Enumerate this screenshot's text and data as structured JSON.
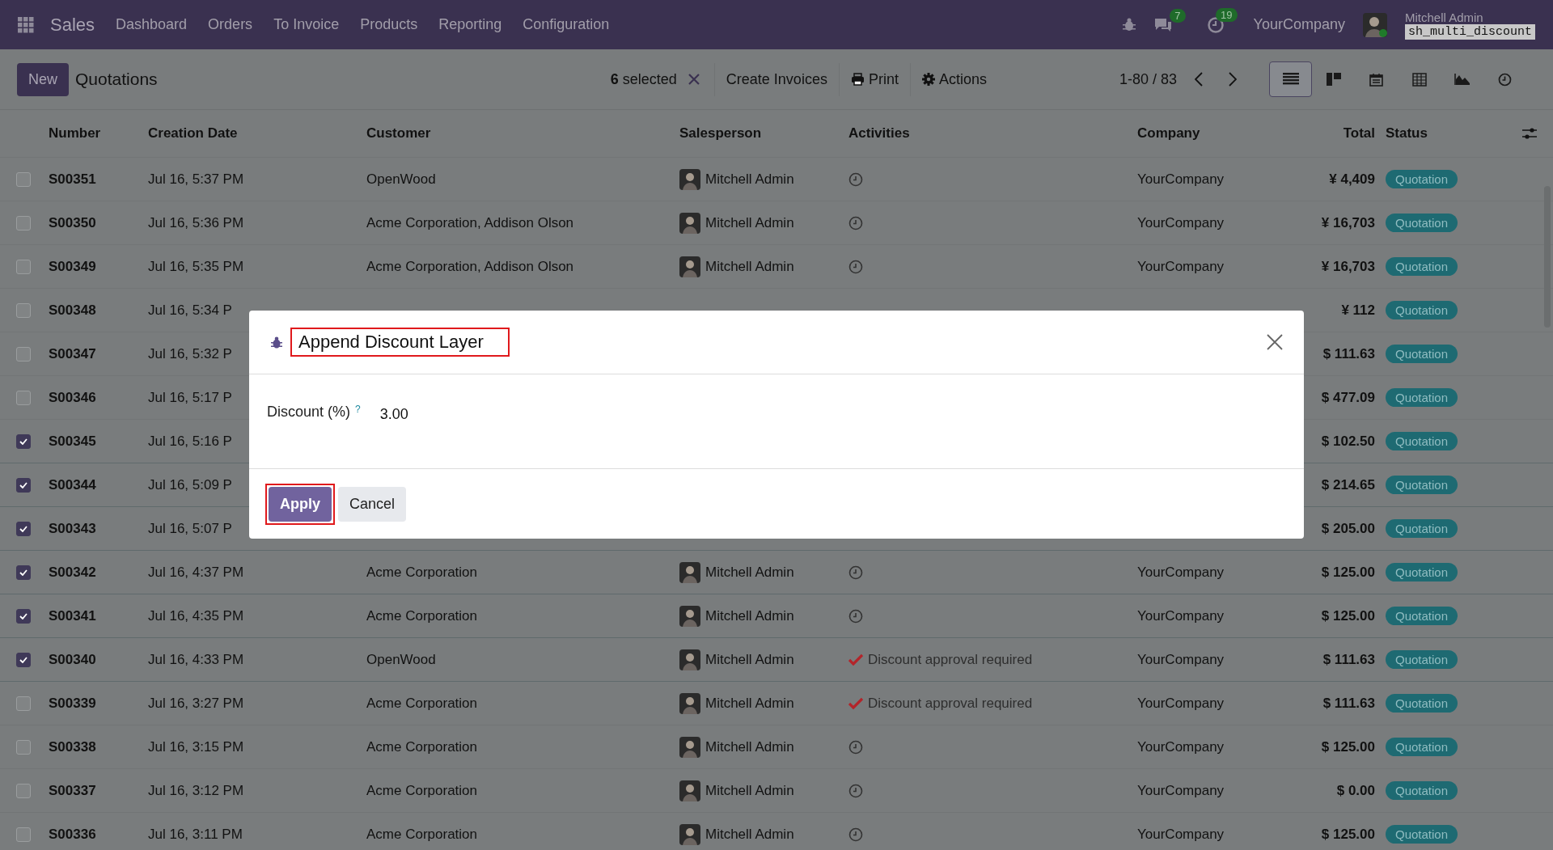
{
  "topbar": {
    "app": "Sales",
    "menu": [
      "Dashboard",
      "Orders",
      "To Invoice",
      "Products",
      "Reporting",
      "Configuration"
    ],
    "chat_count": "7",
    "activity_count": "19",
    "company": "YourCompany",
    "user": "Mitchell Admin",
    "database": "sh_multi_discount"
  },
  "control_bar": {
    "new_button": "New",
    "title": "Quotations",
    "selected_count": "6",
    "selected_label": "selected",
    "actions": [
      {
        "kind": "plain",
        "label": "Create Invoices"
      },
      {
        "kind": "print",
        "label": "Print"
      },
      {
        "kind": "gear",
        "label": "Actions"
      }
    ],
    "pager": "1-80 / 83",
    "views": [
      {
        "kind": "list",
        "selected": true
      },
      {
        "kind": "kanban",
        "selected": false
      },
      {
        "kind": "calendar",
        "selected": false
      },
      {
        "kind": "pivot",
        "selected": false
      },
      {
        "kind": "graph",
        "selected": false
      },
      {
        "kind": "activity",
        "selected": false
      }
    ]
  },
  "table": {
    "columns": [
      "Number",
      "Creation Date",
      "Customer",
      "Salesperson",
      "Activities",
      "Company",
      "Total",
      "Status"
    ],
    "rows": [
      {
        "checked": false,
        "number": "S00351",
        "date": "Jul 16, 5:37 PM",
        "customer": "OpenWood",
        "salesperson": "Mitchell Admin",
        "activity": {
          "kind": "clock"
        },
        "company": "YourCompany",
        "total": "¥ 4,409",
        "status": "Quotation"
      },
      {
        "checked": false,
        "number": "S00350",
        "date": "Jul 16, 5:36 PM",
        "customer": "Acme Corporation, Addison Olson",
        "salesperson": "Mitchell Admin",
        "activity": {
          "kind": "clock"
        },
        "company": "YourCompany",
        "total": "¥ 16,703",
        "status": "Quotation"
      },
      {
        "checked": false,
        "number": "S00349",
        "date": "Jul 16, 5:35 PM",
        "customer": "Acme Corporation, Addison Olson",
        "salesperson": "Mitchell Admin",
        "activity": {
          "kind": "clock"
        },
        "company": "YourCompany",
        "total": "¥ 16,703",
        "status": "Quotation"
      },
      {
        "checked": false,
        "number": "S00348",
        "date": "Jul 16, 5:34 P",
        "total": "¥ 112",
        "status": "Quotation"
      },
      {
        "checked": false,
        "number": "S00347",
        "date": "Jul 16, 5:32 P",
        "total": "$ 111.63",
        "status": "Quotation"
      },
      {
        "checked": false,
        "number": "S00346",
        "date": "Jul 16, 5:17 P",
        "total": "$ 477.09",
        "status": "Quotation"
      },
      {
        "checked": true,
        "number": "S00345",
        "date": "Jul 16, 5:16 P",
        "total": "$ 102.50",
        "status": "Quotation"
      },
      {
        "checked": true,
        "number": "S00344",
        "date": "Jul 16, 5:09 P",
        "total": "$ 214.65",
        "status": "Quotation"
      },
      {
        "checked": true,
        "number": "S00343",
        "date": "Jul 16, 5:07 P",
        "total": "$ 205.00",
        "status": "Quotation"
      },
      {
        "checked": true,
        "number": "S00342",
        "date": "Jul 16, 4:37 PM",
        "customer": "Acme Corporation",
        "salesperson": "Mitchell Admin",
        "activity": {
          "kind": "clock"
        },
        "company": "YourCompany",
        "total": "$ 125.00",
        "status": "Quotation"
      },
      {
        "checked": true,
        "number": "S00341",
        "date": "Jul 16, 4:35 PM",
        "customer": "Acme Corporation",
        "salesperson": "Mitchell Admin",
        "activity": {
          "kind": "clock"
        },
        "company": "YourCompany",
        "total": "$ 125.00",
        "status": "Quotation"
      },
      {
        "checked": true,
        "number": "S00340",
        "date": "Jul 16, 4:33 PM",
        "customer": "OpenWood",
        "salesperson": "Mitchell Admin",
        "activity": {
          "kind": "approval",
          "text": "Discount approval required"
        },
        "company": "YourCompany",
        "total": "$ 111.63",
        "status": "Quotation"
      },
      {
        "checked": false,
        "number": "S00339",
        "date": "Jul 16, 3:27 PM",
        "customer": "Acme Corporation",
        "salesperson": "Mitchell Admin",
        "activity": {
          "kind": "approval",
          "text": "Discount approval required"
        },
        "company": "YourCompany",
        "total": "$ 111.63",
        "status": "Quotation"
      },
      {
        "checked": false,
        "number": "S00338",
        "date": "Jul 16, 3:15 PM",
        "customer": "Acme Corporation",
        "salesperson": "Mitchell Admin",
        "activity": {
          "kind": "clock"
        },
        "company": "YourCompany",
        "total": "$ 125.00",
        "status": "Quotation"
      },
      {
        "checked": false,
        "number": "S00337",
        "date": "Jul 16, 3:12 PM",
        "customer": "Acme Corporation",
        "salesperson": "Mitchell Admin",
        "activity": {
          "kind": "clock"
        },
        "company": "YourCompany",
        "total": "$ 0.00",
        "status": "Quotation"
      },
      {
        "checked": false,
        "number": "S00336",
        "date": "Jul 16, 3:11 PM",
        "customer": "Acme Corporation",
        "salesperson": "Mitchell Admin",
        "activity": {
          "kind": "clock"
        },
        "company": "YourCompany",
        "total": "$ 125.00",
        "status": "Quotation"
      }
    ]
  },
  "dialog": {
    "title": "Append Discount Layer",
    "title_highlighted": true,
    "field_label": "Discount (%)",
    "help_mark": "?",
    "value": "3.00",
    "buttons": [
      {
        "label": "Apply",
        "primary": true,
        "highlighted": true
      },
      {
        "label": "Cancel",
        "primary": false,
        "highlighted": false
      }
    ]
  }
}
